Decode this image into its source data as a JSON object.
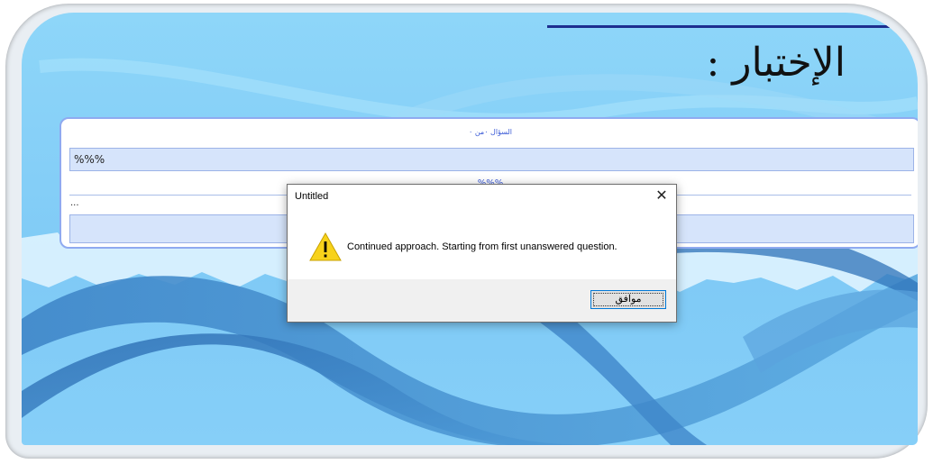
{
  "slide": {
    "title": "الإختبار :",
    "question_counter": "السؤال ٠من ٠",
    "question_text": "%%%",
    "sub_label": "%%%",
    "dots": "...",
    "answer_text": ""
  },
  "dialog": {
    "title": "Untitled",
    "close_symbol": "✕",
    "warning_icon": "warning-icon",
    "message": "Continued approach. Starting from first unanswered question.",
    "ok_label": "موافق"
  },
  "colors": {
    "slide_bg": "#7fcaf6",
    "accent_blue": "#3a5ad6",
    "dark_rule": "#1d2e8f",
    "field_bg": "#d6e4fb",
    "ok_border": "#0078d7",
    "warning_yellow": "#f7d21b"
  }
}
